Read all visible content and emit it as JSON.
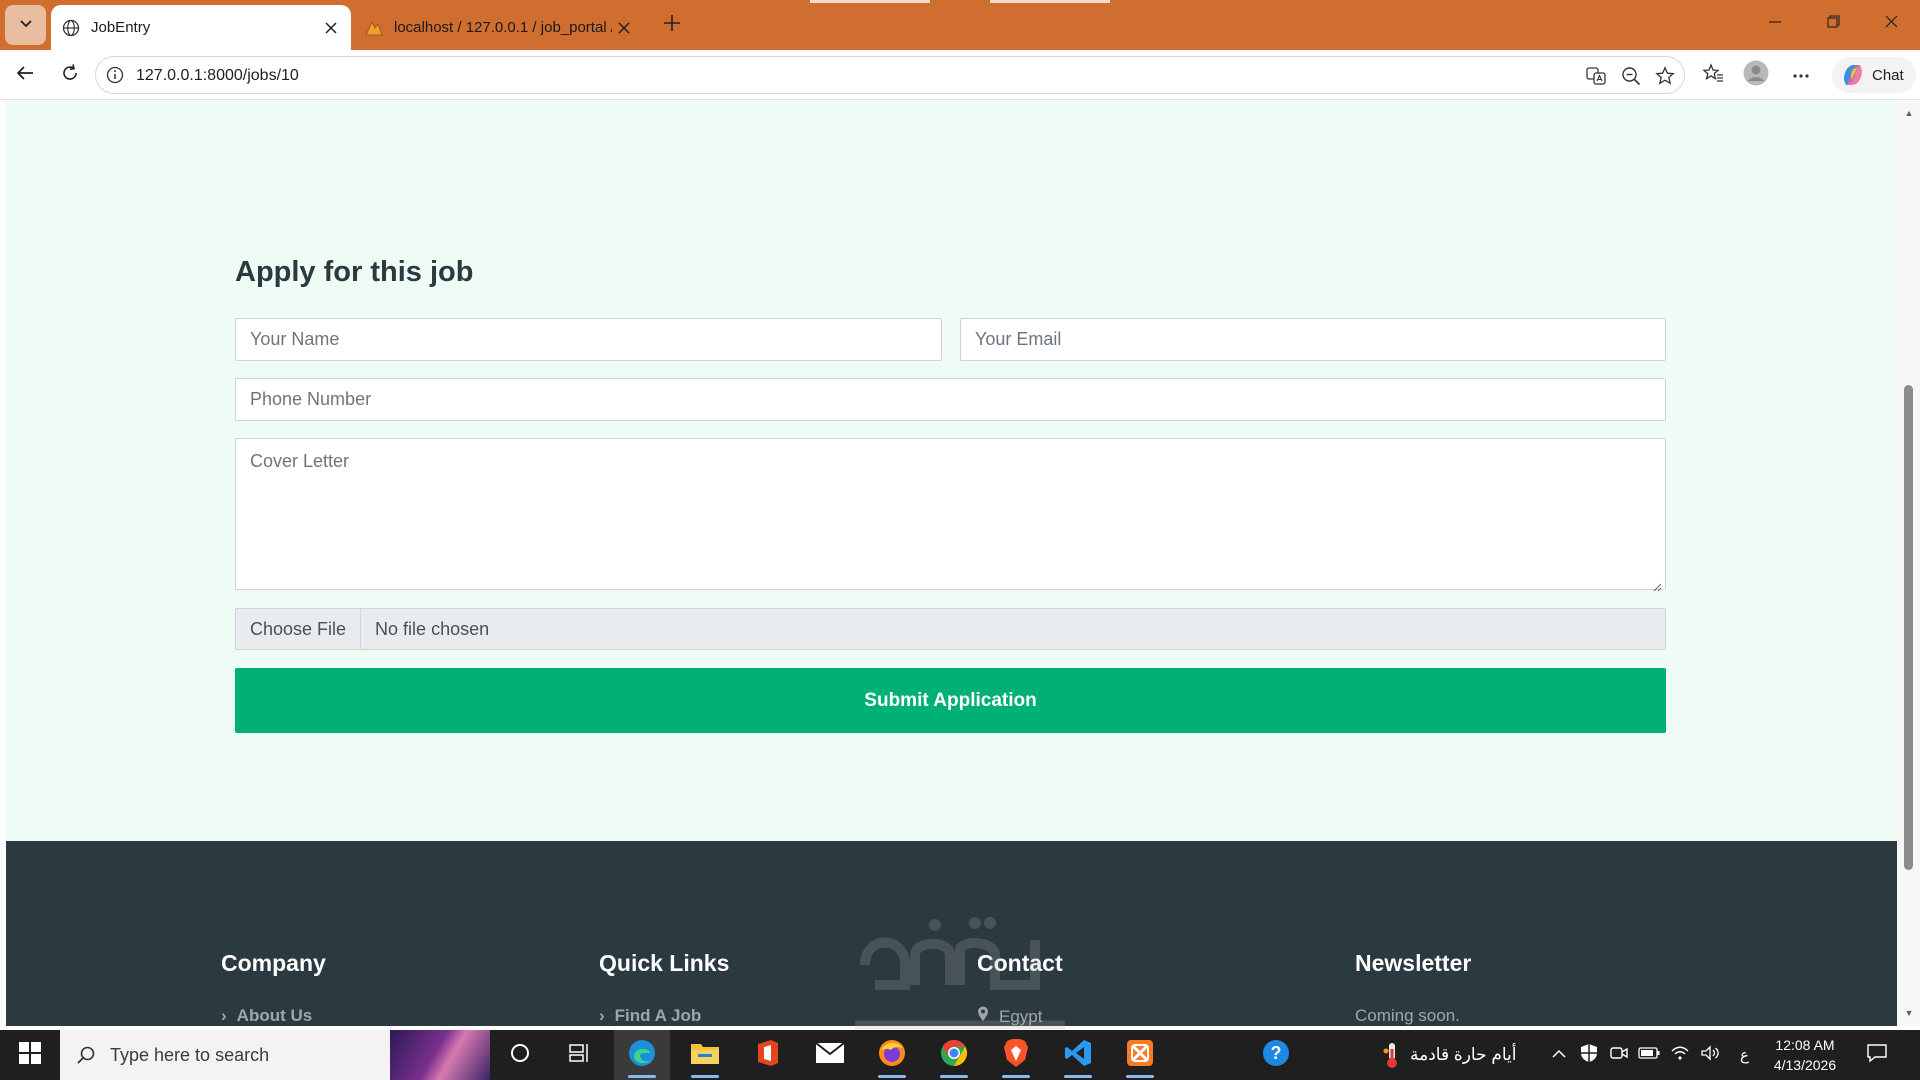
{
  "browser": {
    "tabs": [
      {
        "title": "JobEntry",
        "active": true
      },
      {
        "title": "localhost / 127.0.0.1 / job_portal /",
        "active": false
      }
    ],
    "url": "127.0.0.1:8000/jobs/10",
    "chat_label": "Chat"
  },
  "form": {
    "title": "Apply for this job",
    "name_placeholder": "Your Name",
    "email_placeholder": "Your Email",
    "phone_placeholder": "Phone Number",
    "cover_letter_placeholder": "Cover Letter",
    "file_button_label": "Choose File",
    "file_status": "No file chosen",
    "submit_label": "Submit Application"
  },
  "footer": {
    "columns": [
      {
        "heading": "Company",
        "first_item": "About Us",
        "has_chevron": true
      },
      {
        "heading": "Quick Links",
        "first_item": "Find A Job",
        "has_chevron": true
      },
      {
        "heading": "Contact",
        "first_item": "Egypt",
        "has_pin": true
      },
      {
        "heading": "Newsletter",
        "first_item": "Coming soon."
      }
    ]
  },
  "taskbar": {
    "search_placeholder": "Type here to search",
    "weather_text": "أيام حارة قادمة",
    "input_language": "ع",
    "time": "12:08 AM",
    "date": "4/13/2026"
  },
  "colors": {
    "titlebar": "#cf6e2e",
    "page_background": "#effcf5",
    "accent_green": "#00b074",
    "footer_background": "#2b3940",
    "heading_text": "#2b3940"
  }
}
